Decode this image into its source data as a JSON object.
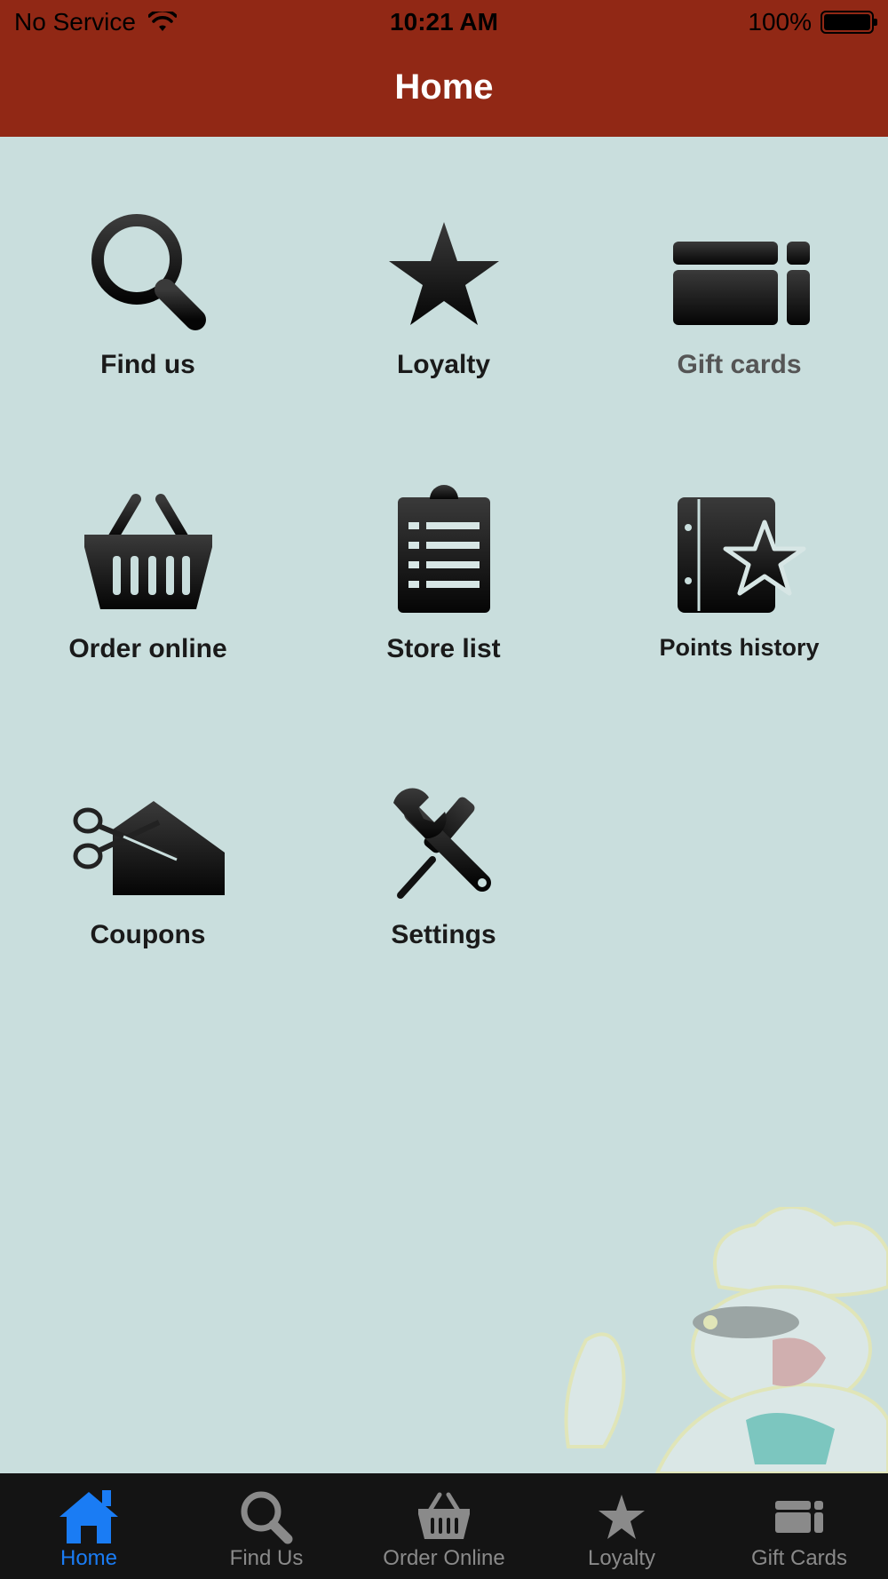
{
  "status_bar": {
    "carrier": "No Service",
    "time": "10:21 AM",
    "battery": "100%"
  },
  "nav": {
    "title": "Home"
  },
  "grid": {
    "items": [
      {
        "label": "Find us",
        "icon": "magnifier-icon"
      },
      {
        "label": "Loyalty",
        "icon": "star-icon"
      },
      {
        "label": "Gift cards",
        "icon": "gift-card-icon"
      },
      {
        "label": "Order online",
        "icon": "basket-icon"
      },
      {
        "label": "Store list",
        "icon": "clipboard-list-icon"
      },
      {
        "label": "Points history",
        "icon": "book-star-icon"
      },
      {
        "label": "Coupons",
        "icon": "scissors-coupon-icon"
      },
      {
        "label": "Settings",
        "icon": "wrench-screwdriver-icon"
      }
    ]
  },
  "tab_bar": {
    "tabs": [
      {
        "label": "Home",
        "icon": "home-icon",
        "active": true
      },
      {
        "label": "Find Us",
        "icon": "magnifier-icon",
        "active": false
      },
      {
        "label": "Order Online",
        "icon": "basket-icon",
        "active": false
      },
      {
        "label": "Loyalty",
        "icon": "star-icon",
        "active": false
      },
      {
        "label": "Gift Cards",
        "icon": "gift-card-icon",
        "active": false
      }
    ]
  },
  "colors": {
    "header": "#912815",
    "background": "#c9dedd",
    "tab_active": "#1a7cf4",
    "tab_inactive": "#8a8a8a",
    "tab_bar": "#141414"
  }
}
